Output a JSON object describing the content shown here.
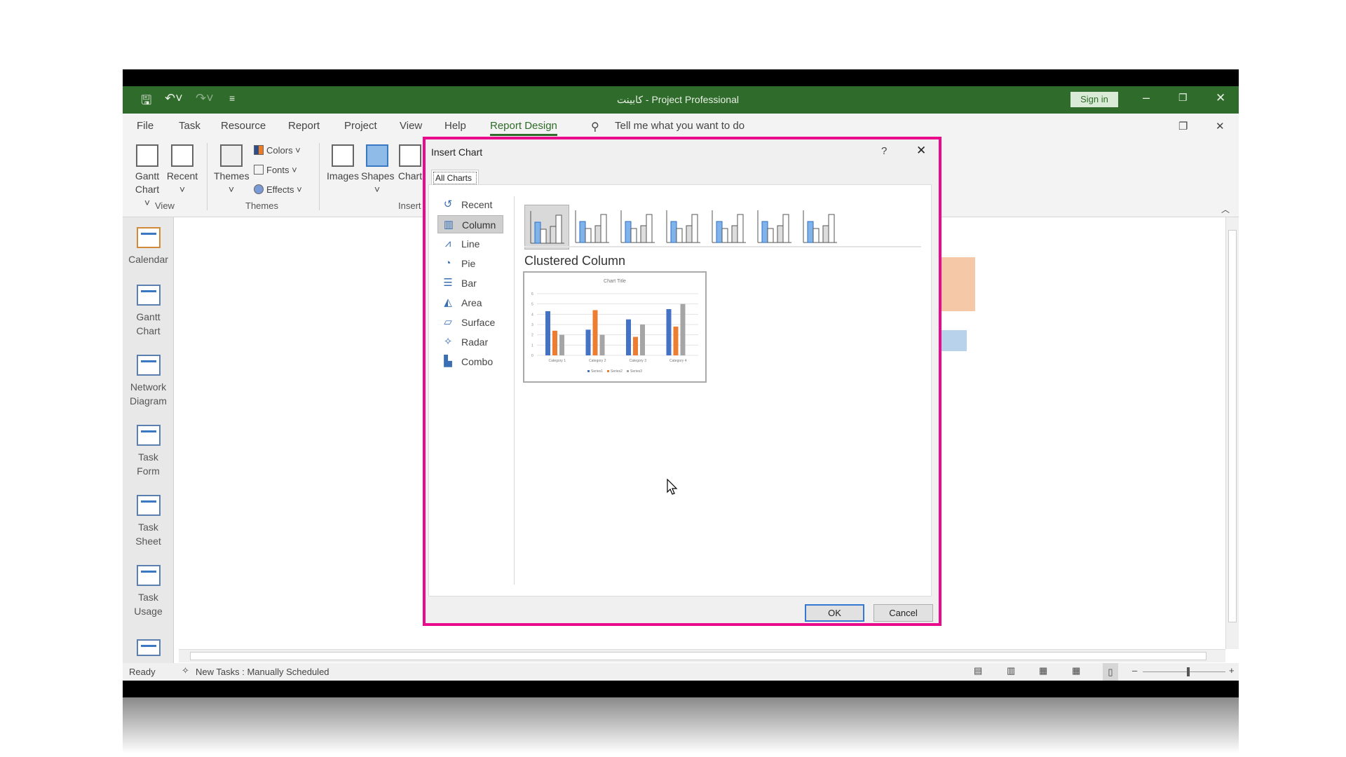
{
  "window": {
    "title": "کابینت  -  Project Professional",
    "sign_in": "Sign in",
    "qat": {
      "icons": [
        "save-icon",
        "undo-icon",
        "redo-icon",
        "customize-icon"
      ]
    }
  },
  "tabs": [
    "File",
    "Task",
    "Resource",
    "Report",
    "Project",
    "View",
    "Help",
    "Report Design"
  ],
  "active_tab": "Report Design",
  "tell_me": "Tell me what you want to do",
  "ribbon": {
    "view_group": {
      "label": "View",
      "gantt": "Gantt",
      "gantt2": "Chart ˅",
      "recent": "Recent",
      "recent2": "˅"
    },
    "themes_group": {
      "label": "Themes",
      "themes": "Themes",
      "themes2": "˅",
      "colors": "Colors ˅",
      "fonts": "Fonts ˅",
      "effects": "Effects ˅"
    },
    "insert_group": {
      "label": "Insert",
      "images": "Images",
      "shapes": "Shapes",
      "shapes2": "˅",
      "chart": "Chart"
    }
  },
  "sidebar": [
    {
      "l1": "Calendar",
      "l2": ""
    },
    {
      "l1": "Gantt",
      "l2": "Chart"
    },
    {
      "l1": "Network",
      "l2": "Diagram"
    },
    {
      "l1": "Task",
      "l2": "Form"
    },
    {
      "l1": "Task",
      "l2": "Sheet"
    },
    {
      "l1": "Task",
      "l2": "Usage"
    }
  ],
  "status": {
    "ready": "Ready",
    "new_tasks": "New Tasks : Manually Scheduled",
    "zoom_level": 0.55
  },
  "dialog": {
    "title": "Insert Chart",
    "help": "?",
    "close": "✕",
    "tab": "All Charts",
    "types": [
      "Recent",
      "Column",
      "Line",
      "Pie",
      "Bar",
      "Area",
      "Surface",
      "Radar",
      "Combo"
    ],
    "type_icons": [
      "↺",
      "▥",
      "⩘",
      "◔",
      "☰",
      "◭",
      "▱",
      "✧",
      "▙"
    ],
    "selected_type": "Column",
    "subtype_title": "Clustered Column",
    "preview": {
      "title": "Chart Title",
      "categories": [
        "Category 1",
        "Category 2",
        "Category 3",
        "Category 4"
      ],
      "y_ticks": [
        "0",
        "1",
        "2",
        "3",
        "4",
        "5",
        "6"
      ],
      "ylim": [
        0,
        6
      ],
      "series": [
        {
          "name": "Series1",
          "color": "#4472c4",
          "values": [
            4.3,
            2.5,
            3.5,
            4.5
          ]
        },
        {
          "name": "Series2",
          "color": "#ed7d31",
          "values": [
            2.4,
            4.4,
            1.8,
            2.8
          ]
        },
        {
          "name": "Series3",
          "color": "#a5a5a5",
          "values": [
            2.0,
            2.0,
            3.0,
            5.0
          ]
        }
      ]
    },
    "ok": "OK",
    "cancel": "Cancel"
  },
  "colors": {
    "title_green": "#2f6b2a",
    "highlight_border": "#ea0b8c"
  }
}
